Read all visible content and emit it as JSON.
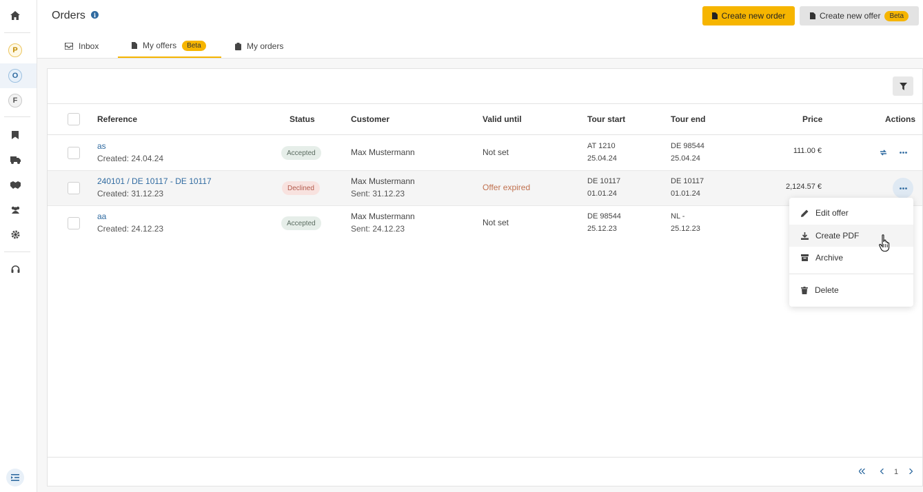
{
  "page": {
    "title": "Orders"
  },
  "header": {
    "create_order_label": "Create new order",
    "create_offer_label": "Create new offer",
    "beta_label": "Beta"
  },
  "sidebar": {
    "letters": [
      "P",
      "O",
      "F"
    ]
  },
  "tabs": [
    {
      "label": "Inbox",
      "icon": "inbox-icon"
    },
    {
      "label": "My offers",
      "icon": "document-icon",
      "badge": "Beta",
      "active": true
    },
    {
      "label": "My orders",
      "icon": "clipboard-icon"
    }
  ],
  "table": {
    "columns": [
      "Reference",
      "Status",
      "Customer",
      "Valid until",
      "Tour start",
      "Tour end",
      "Price",
      "Actions"
    ],
    "rows": [
      {
        "reference": "as",
        "created": "Created: 24.04.24",
        "status": "Accepted",
        "customer": "Max Mustermann",
        "sent": "",
        "valid_until": "Not set",
        "tour_start": "AT 1210",
        "tour_start_date": "25.04.24",
        "tour_end": "DE 98544",
        "tour_end_date": "25.04.24",
        "price": "111.00 €"
      },
      {
        "reference": "240101 / DE 10117 - DE 10117",
        "created": "Created: 31.12.23",
        "status": "Declined",
        "customer": "Max Mustermann",
        "sent": "Sent: 31.12.23",
        "valid_until": "Offer expired",
        "tour_start": "DE 10117",
        "tour_start_date": "01.01.24",
        "tour_end": "DE 10117",
        "tour_end_date": "01.01.24",
        "price": "2,124.57 €"
      },
      {
        "reference": "aa",
        "created": "Created: 24.12.23",
        "status": "Accepted",
        "customer": "Max Mustermann",
        "sent": "Sent: 24.12.23",
        "valid_until": "Not set",
        "tour_start": "DE 98544",
        "tour_start_date": "25.12.23",
        "tour_end": "NL -",
        "tour_end_date": "25.12.23",
        "price": ""
      }
    ]
  },
  "menu": {
    "edit": "Edit offer",
    "pdf": "Create PDF",
    "archive": "Archive",
    "delete": "Delete"
  },
  "pagination": {
    "page": "1"
  },
  "colors": {
    "accent": "#f6b500",
    "link": "#2f6aa0",
    "declined": "#b25a4c"
  }
}
